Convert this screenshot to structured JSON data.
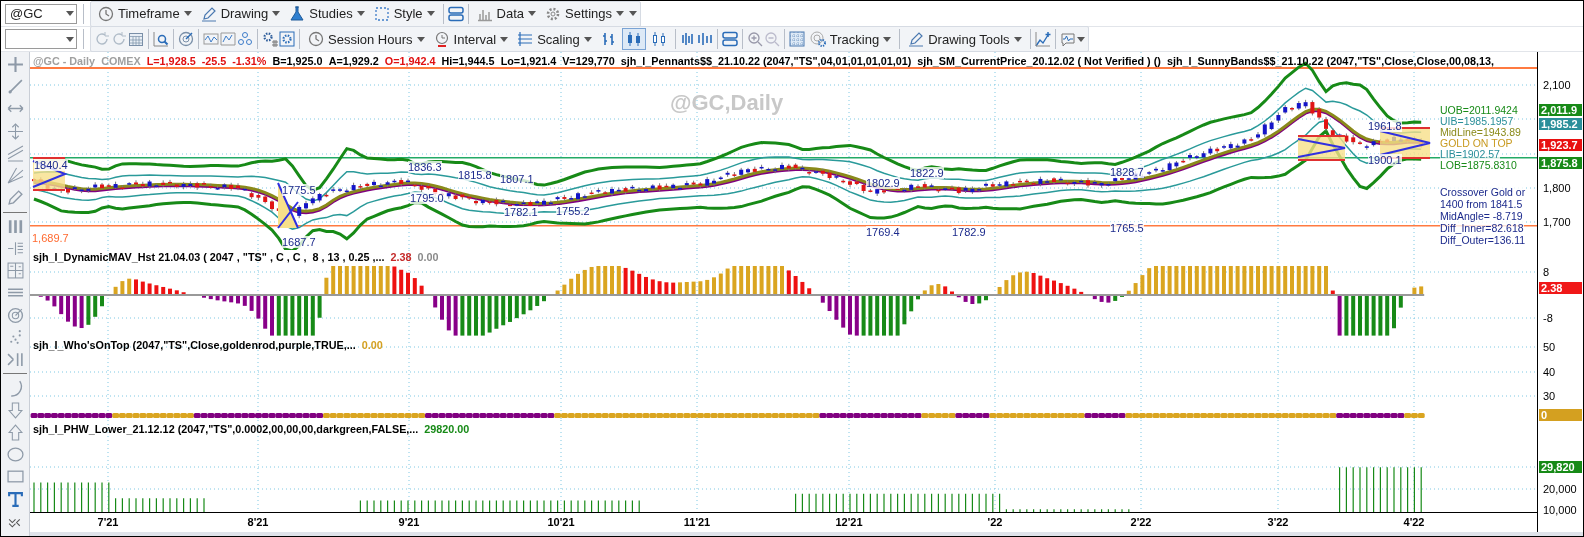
{
  "toolbar_top": {
    "symbol": "@GC",
    "menus": [
      "Timeframe",
      "Drawing",
      "Studies",
      "Style",
      "Data",
      "Settings"
    ]
  },
  "toolbar_bottom": {
    "buttons": [
      "Session Hours",
      "Interval",
      "Scaling",
      "Tracking",
      "Drawing Tools"
    ],
    "bar_style_toggles": [
      {
        "selected": false
      },
      {
        "selected": true
      },
      {
        "selected": false
      }
    ]
  },
  "price_pane": {
    "header": [
      {
        "text": "@GC - Daily",
        "kind": "title"
      },
      {
        "text": "COMEX",
        "kind": "title"
      },
      {
        "text": "L=1,928.5",
        "kind": "down"
      },
      {
        "text": "-25.5",
        "kind": "down"
      },
      {
        "text": "-1.31%",
        "kind": "down"
      },
      {
        "text": "B=1,925.0",
        "kind": "quote"
      },
      {
        "text": "A=1,929.2",
        "kind": "quote"
      },
      {
        "text": "O=1,942.4",
        "kind": "down"
      },
      {
        "text": "Hi=1,944.5",
        "kind": "quote"
      },
      {
        "text": "Lo=1,921.4",
        "kind": "quote"
      },
      {
        "text": "V=129,770",
        "kind": "quote"
      },
      {
        "text": "sjh_I_Pennants$$_21.10.22 (2047,\"TS\",04,01,01,01,01,01)",
        "kind": "study"
      },
      {
        "text": "sjh_SM_CurrentPrice_20.12.02 ( Not Verified ) ()",
        "kind": "study"
      },
      {
        "text": "sjh_I_SunnyBands$$_21.10.22 (2047,\"TS\",Close,Close,00,08,13,",
        "kind": "study"
      }
    ],
    "watermark": "@GC,Daily",
    "annotations": [
      "1840.4",
      "1775.5",
      "1687.7",
      "1836.3",
      "1795.0",
      "1815.8",
      "1807.1",
      "1782.1",
      "1755.2",
      "1802.9",
      "1822.9",
      "1769.4",
      "1782.9",
      "1828.7",
      "1765.5",
      "1961.8",
      "1900.1"
    ],
    "left_label": "1,689.7",
    "band_labels": [
      {
        "text": "UOB=2011.9424",
        "color": "#178a17"
      },
      {
        "text": "UIB=1985.1957",
        "color": "#2a8f9a"
      },
      {
        "text": "MidLine=1943.89",
        "color": "#8a8a1a"
      },
      {
        "text": "GOLD ON TOP",
        "color": "#c89a20"
      },
      {
        "text": "LIB=1902.57",
        "color": "#2a8f9a"
      },
      {
        "text": "LOB=1875.8310",
        "color": "#178a17"
      }
    ],
    "info_lines": [
      "Crossover Gold or",
      "1400 from 1841.5",
      "MidAngle= -8.719",
      "Diff_Inner=82.618",
      "Diff_Outer=136.11"
    ],
    "axis_ticks": [
      "2,100",
      "1,800",
      "1,700"
    ],
    "axis_tags": [
      {
        "text": "2,011.9",
        "color": "#178a17"
      },
      {
        "text": "1,985.2",
        "color": "#2a8f9a"
      },
      {
        "text": "1,923.7",
        "color": "#e81010"
      },
      {
        "text": "1,875.8",
        "color": "#178a17"
      }
    ]
  },
  "dmav_pane": {
    "title": "sjh_I_DynamicMAV_Hst 21.04.03 ( 2047 , \"TS\" , C , C ,  8 , 13 , 0.25 ,...",
    "values": [
      {
        "text": "2.38",
        "color": "#c42a2a"
      },
      {
        "text": "0.00",
        "color": "#8a8a8a"
      }
    ],
    "axis_ticks": [
      "8",
      "-8"
    ],
    "axis_tags": [
      {
        "text": "2.38",
        "color": "#f01818"
      }
    ]
  },
  "whos_on_top_pane": {
    "title": "sjh_I_Who'sOnTop (2047,\"TS\",Close,goldenrod,purple,TRUE,...",
    "values": [
      {
        "text": "0.00",
        "color": "#d4a020"
      }
    ],
    "axis_ticks": [
      "50",
      "40",
      "30"
    ],
    "axis_tags": [
      {
        "text": "0",
        "color": "#d4a020"
      }
    ]
  },
  "phw_pane": {
    "title": "sjh_I_PHW_Lower_21.12.12 (2047,\"TS\",0.0002,00,00,00,darkgreen,FALSE,...",
    "values": [
      {
        "text": "29820.00",
        "color": "#178a17"
      }
    ],
    "axis_ticks": [
      "20,000",
      "10,000"
    ],
    "axis_tags": [
      {
        "text": "29,820",
        "color": "#178a17"
      }
    ]
  },
  "x_axis": {
    "labels": [
      "7'21",
      "8'21",
      "9'21",
      "10'21",
      "11'21",
      "12'21",
      "'22",
      "2'22",
      "3'22",
      "4'22"
    ]
  }
}
